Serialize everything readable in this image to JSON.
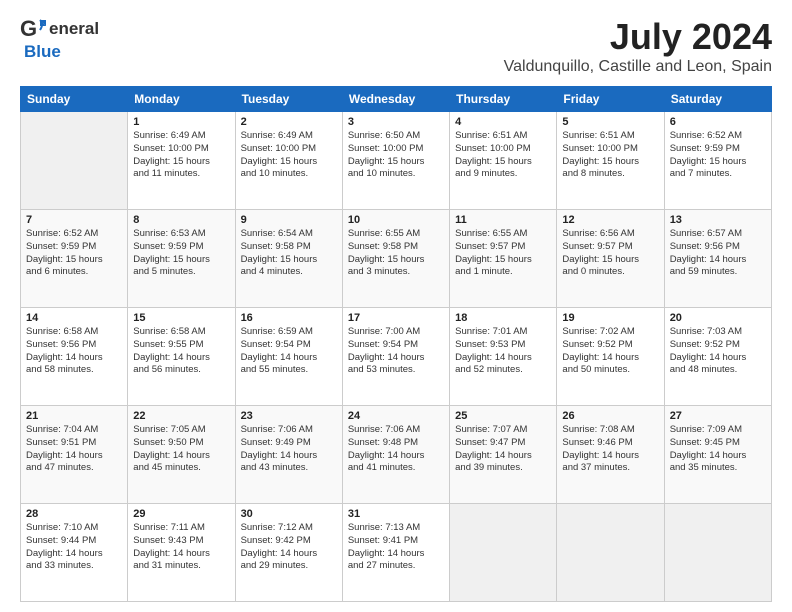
{
  "header": {
    "logo": {
      "line1": "General",
      "line2": "Blue"
    },
    "title": "July 2024",
    "subtitle": "Valdunquillo, Castille and Leon, Spain"
  },
  "days_header": [
    "Sunday",
    "Monday",
    "Tuesday",
    "Wednesday",
    "Thursday",
    "Friday",
    "Saturday"
  ],
  "weeks": [
    [
      {
        "num": "",
        "detail": ""
      },
      {
        "num": "1",
        "detail": "Sunrise: 6:49 AM\nSunset: 10:00 PM\nDaylight: 15 hours\nand 11 minutes."
      },
      {
        "num": "2",
        "detail": "Sunrise: 6:49 AM\nSunset: 10:00 PM\nDaylight: 15 hours\nand 10 minutes."
      },
      {
        "num": "3",
        "detail": "Sunrise: 6:50 AM\nSunset: 10:00 PM\nDaylight: 15 hours\nand 10 minutes."
      },
      {
        "num": "4",
        "detail": "Sunrise: 6:51 AM\nSunset: 10:00 PM\nDaylight: 15 hours\nand 9 minutes."
      },
      {
        "num": "5",
        "detail": "Sunrise: 6:51 AM\nSunset: 10:00 PM\nDaylight: 15 hours\nand 8 minutes."
      },
      {
        "num": "6",
        "detail": "Sunrise: 6:52 AM\nSunset: 9:59 PM\nDaylight: 15 hours\nand 7 minutes."
      }
    ],
    [
      {
        "num": "7",
        "detail": "Sunrise: 6:52 AM\nSunset: 9:59 PM\nDaylight: 15 hours\nand 6 minutes."
      },
      {
        "num": "8",
        "detail": "Sunrise: 6:53 AM\nSunset: 9:59 PM\nDaylight: 15 hours\nand 5 minutes."
      },
      {
        "num": "9",
        "detail": "Sunrise: 6:54 AM\nSunset: 9:58 PM\nDaylight: 15 hours\nand 4 minutes."
      },
      {
        "num": "10",
        "detail": "Sunrise: 6:55 AM\nSunset: 9:58 PM\nDaylight: 15 hours\nand 3 minutes."
      },
      {
        "num": "11",
        "detail": "Sunrise: 6:55 AM\nSunset: 9:57 PM\nDaylight: 15 hours\nand 1 minute."
      },
      {
        "num": "12",
        "detail": "Sunrise: 6:56 AM\nSunset: 9:57 PM\nDaylight: 15 hours\nand 0 minutes."
      },
      {
        "num": "13",
        "detail": "Sunrise: 6:57 AM\nSunset: 9:56 PM\nDaylight: 14 hours\nand 59 minutes."
      }
    ],
    [
      {
        "num": "14",
        "detail": "Sunrise: 6:58 AM\nSunset: 9:56 PM\nDaylight: 14 hours\nand 58 minutes."
      },
      {
        "num": "15",
        "detail": "Sunrise: 6:58 AM\nSunset: 9:55 PM\nDaylight: 14 hours\nand 56 minutes."
      },
      {
        "num": "16",
        "detail": "Sunrise: 6:59 AM\nSunset: 9:54 PM\nDaylight: 14 hours\nand 55 minutes."
      },
      {
        "num": "17",
        "detail": "Sunrise: 7:00 AM\nSunset: 9:54 PM\nDaylight: 14 hours\nand 53 minutes."
      },
      {
        "num": "18",
        "detail": "Sunrise: 7:01 AM\nSunset: 9:53 PM\nDaylight: 14 hours\nand 52 minutes."
      },
      {
        "num": "19",
        "detail": "Sunrise: 7:02 AM\nSunset: 9:52 PM\nDaylight: 14 hours\nand 50 minutes."
      },
      {
        "num": "20",
        "detail": "Sunrise: 7:03 AM\nSunset: 9:52 PM\nDaylight: 14 hours\nand 48 minutes."
      }
    ],
    [
      {
        "num": "21",
        "detail": "Sunrise: 7:04 AM\nSunset: 9:51 PM\nDaylight: 14 hours\nand 47 minutes."
      },
      {
        "num": "22",
        "detail": "Sunrise: 7:05 AM\nSunset: 9:50 PM\nDaylight: 14 hours\nand 45 minutes."
      },
      {
        "num": "23",
        "detail": "Sunrise: 7:06 AM\nSunset: 9:49 PM\nDaylight: 14 hours\nand 43 minutes."
      },
      {
        "num": "24",
        "detail": "Sunrise: 7:06 AM\nSunset: 9:48 PM\nDaylight: 14 hours\nand 41 minutes."
      },
      {
        "num": "25",
        "detail": "Sunrise: 7:07 AM\nSunset: 9:47 PM\nDaylight: 14 hours\nand 39 minutes."
      },
      {
        "num": "26",
        "detail": "Sunrise: 7:08 AM\nSunset: 9:46 PM\nDaylight: 14 hours\nand 37 minutes."
      },
      {
        "num": "27",
        "detail": "Sunrise: 7:09 AM\nSunset: 9:45 PM\nDaylight: 14 hours\nand 35 minutes."
      }
    ],
    [
      {
        "num": "28",
        "detail": "Sunrise: 7:10 AM\nSunset: 9:44 PM\nDaylight: 14 hours\nand 33 minutes."
      },
      {
        "num": "29",
        "detail": "Sunrise: 7:11 AM\nSunset: 9:43 PM\nDaylight: 14 hours\nand 31 minutes."
      },
      {
        "num": "30",
        "detail": "Sunrise: 7:12 AM\nSunset: 9:42 PM\nDaylight: 14 hours\nand 29 minutes."
      },
      {
        "num": "31",
        "detail": "Sunrise: 7:13 AM\nSunset: 9:41 PM\nDaylight: 14 hours\nand 27 minutes."
      },
      {
        "num": "",
        "detail": ""
      },
      {
        "num": "",
        "detail": ""
      },
      {
        "num": "",
        "detail": ""
      }
    ]
  ]
}
